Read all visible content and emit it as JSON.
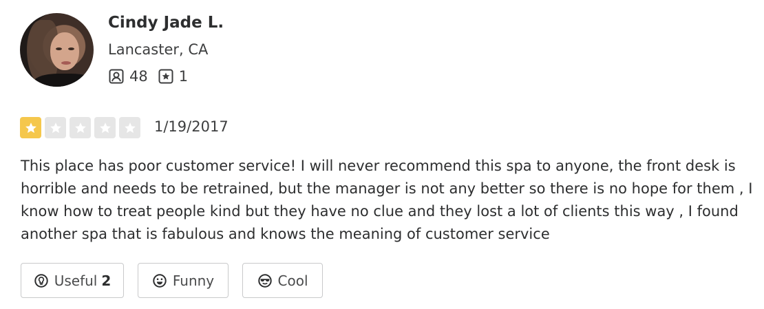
{
  "reviewer": {
    "name": "Cindy Jade L.",
    "location": "Lancaster, CA",
    "friends_count": "48",
    "reviews_count": "1"
  },
  "rating": {
    "value": 1,
    "max": 5,
    "date": "1/19/2017"
  },
  "review_text": "This place has poor customer service! I will never recommend this spa to anyone, the front desk is horrible and needs to be retrained, but the manager is not any better so there is no hope for them , I know how to treat people kind but they have no clue and they lost a lot of clients this way , I found another spa that is fabulous and knows the meaning of customer service",
  "actions": {
    "useful_label": "Useful",
    "useful_count": "2",
    "funny_label": "Funny",
    "cool_label": "Cool"
  },
  "colors": {
    "star_on": "#f5c74c",
    "star_off": "#e6e6e6"
  }
}
